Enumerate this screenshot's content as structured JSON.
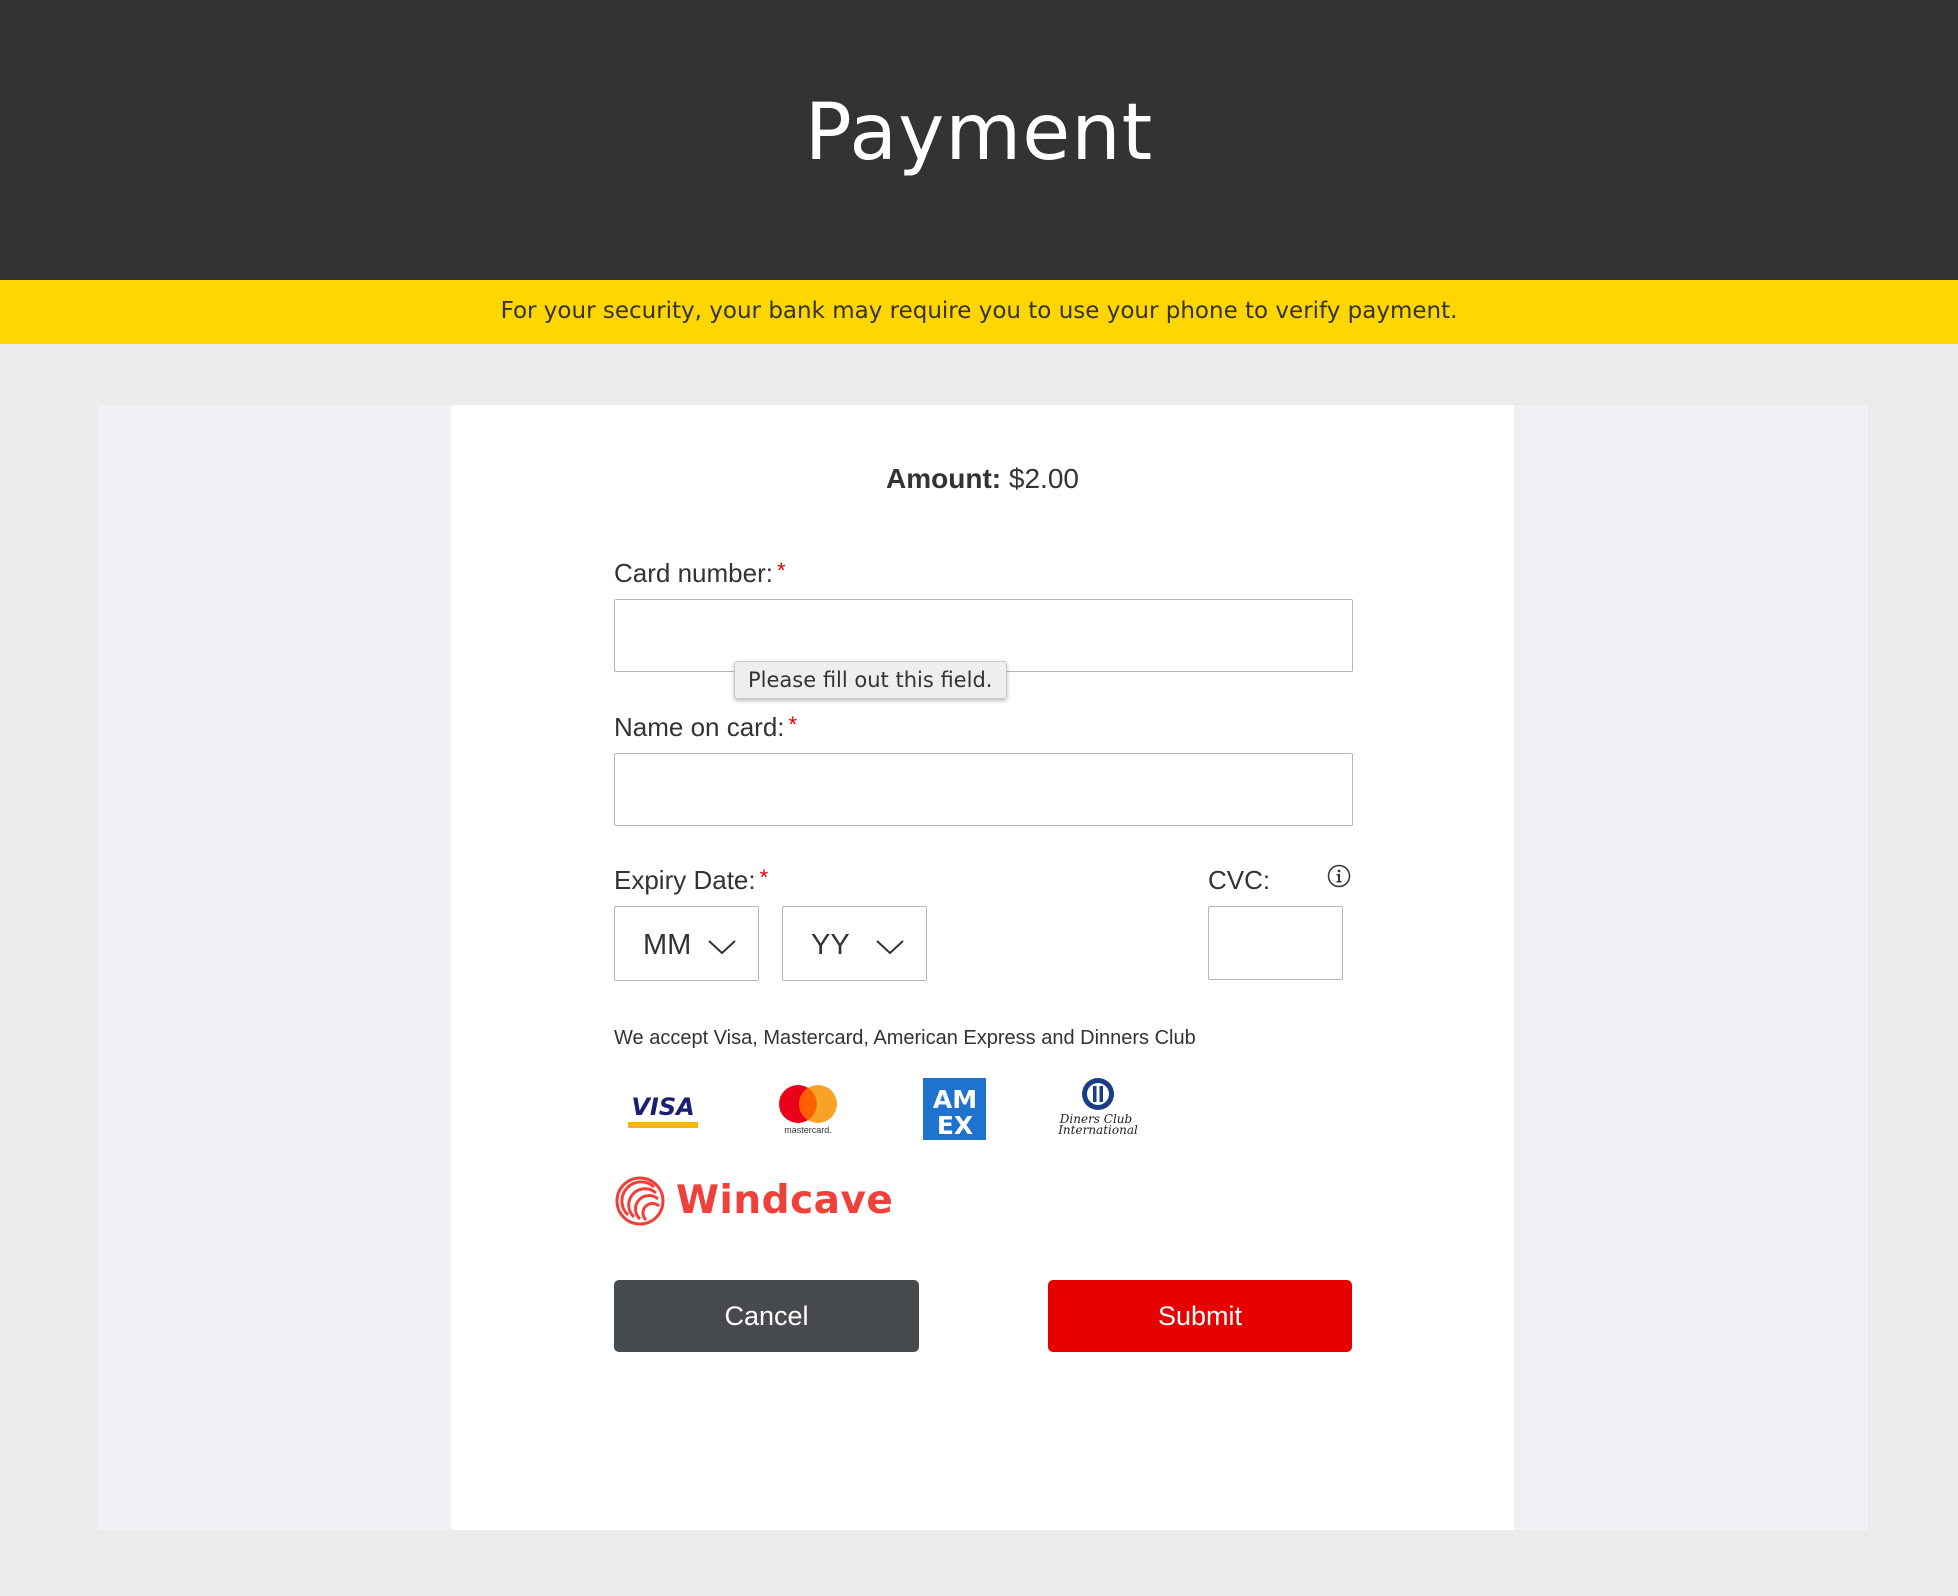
{
  "header": {
    "title": "Payment"
  },
  "notice": {
    "text": "For your security, your bank may require you to use your phone to verify payment."
  },
  "amount": {
    "label": "Amount:",
    "value": "$2.00"
  },
  "fields": {
    "card_number": {
      "label": "Card number:",
      "required_mark": "*",
      "value": ""
    },
    "name_on_card": {
      "label": "Name on card:",
      "required_mark": "*",
      "value": ""
    },
    "expiry": {
      "label": "Expiry Date:",
      "required_mark": "*",
      "month": {
        "selected": "MM"
      },
      "year": {
        "selected": "YY"
      }
    },
    "cvc": {
      "label": "CVC:",
      "value": "",
      "info_icon": "info-icon"
    }
  },
  "validation_tooltip": "Please fill out this field.",
  "accepted_cards": {
    "text": "We accept Visa, Mastercard, American Express and Dinners Club",
    "logos": [
      {
        "name": "visa-logo",
        "text": "VISA"
      },
      {
        "name": "mastercard-logo",
        "text": "mastercard"
      },
      {
        "name": "amex-logo",
        "text": "AM EX"
      },
      {
        "name": "diners-club-logo",
        "text": "Diners Club International"
      }
    ]
  },
  "provider": {
    "name": "Windcave"
  },
  "buttons": {
    "cancel": "Cancel",
    "submit": "Submit"
  },
  "colors": {
    "header_bg": "#333333",
    "notice_bg": "#ffd600",
    "submit": "#e60000",
    "cancel": "#474b4d",
    "windcave": "#f0403a",
    "required": "#e00000"
  }
}
